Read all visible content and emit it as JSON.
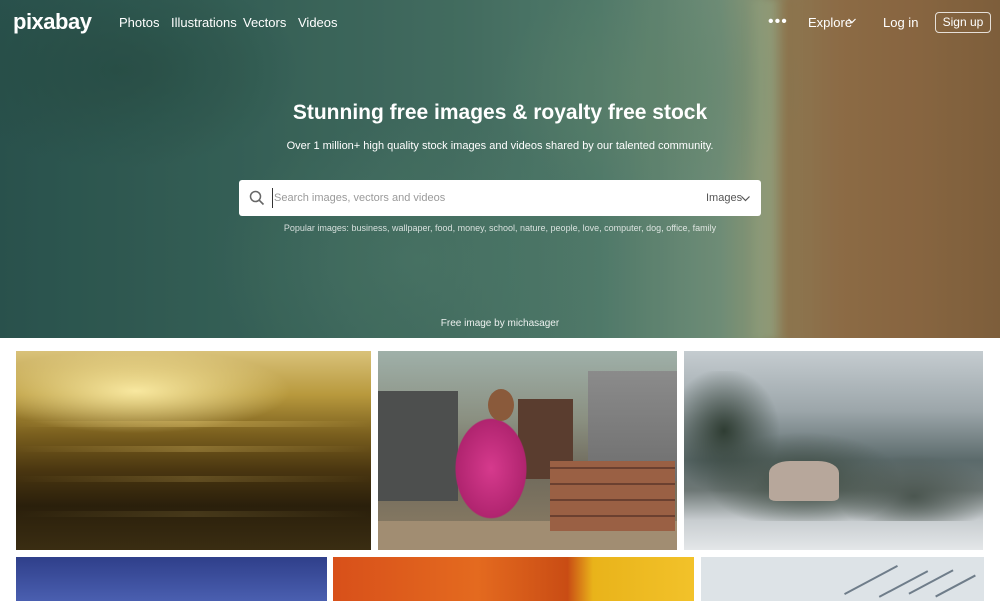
{
  "nav": {
    "logo": "pixabay",
    "links": [
      "Photos",
      "Illustrations",
      "Vectors",
      "Videos"
    ],
    "more_icon": "more-dots-icon",
    "explore": "Explore",
    "login": "Log in",
    "signup": "Sign up"
  },
  "hero": {
    "title": "Stunning free images & royalty free stock",
    "subtitle": "Over 1 million+ high quality stock images and videos shared by our talented community.",
    "search": {
      "placeholder": "Search images, vectors and videos",
      "value": "",
      "type": "Images",
      "icon": "search-icon"
    },
    "popular_label": "Popular images:",
    "popular_terms": [
      "business",
      "wallpaper",
      "food",
      "money",
      "school",
      "nature",
      "people",
      "love",
      "computer",
      "dog",
      "office",
      "family"
    ],
    "credit": "Free image by michasager"
  },
  "colors": {
    "hero_water": "#3d6d62",
    "hero_sand": "#a07a4f",
    "text_white": "#ffffff"
  }
}
